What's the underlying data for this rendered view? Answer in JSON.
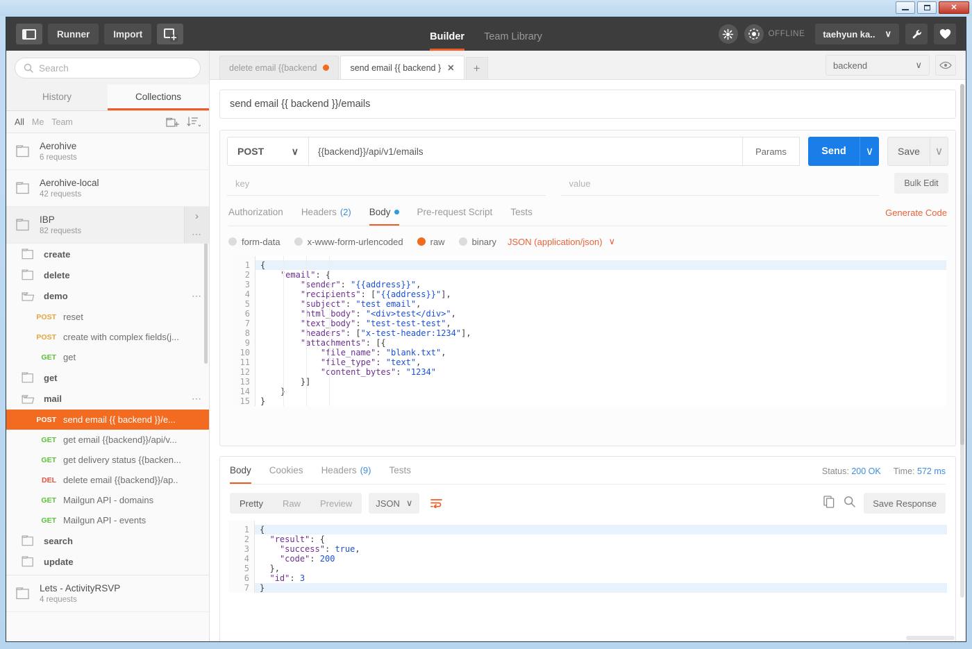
{
  "window": {
    "minimize_label": "minimize",
    "maximize_label": "maximize",
    "close_label": "✕"
  },
  "topnav": {
    "sidebar_toggle": "toggle-sidebar",
    "runner_label": "Runner",
    "import_label": "Import",
    "new_tab_label": "new-window",
    "center": [
      {
        "label": "Builder",
        "active": true
      },
      {
        "label": "Team Library",
        "active": false
      }
    ],
    "sync_icon": "broadcast-icon",
    "status_icon": "orbit-icon",
    "status_label": "OFFLINE",
    "user_name": "taehyun ka..",
    "user_caret": "∨",
    "wrench_icon": "wrench-icon",
    "heart_icon": "heart-icon"
  },
  "sidebar": {
    "search": {
      "placeholder": "Search"
    },
    "tabs": [
      {
        "label": "History",
        "active": false
      },
      {
        "label": "Collections",
        "active": true
      }
    ],
    "filters": [
      {
        "label": "All",
        "active": true
      },
      {
        "label": "Me",
        "active": false
      },
      {
        "label": "Team",
        "active": false
      }
    ],
    "new_folder_icon": "new-folder-icon",
    "sort_icon": "sort-icon",
    "collections": [
      {
        "name": "Aerohive",
        "requests": "6 requests"
      },
      {
        "name": "Aerohive-local",
        "requests": "42 requests"
      },
      {
        "name": "IBP",
        "requests": "82 requests",
        "expanded": true
      }
    ],
    "tree": [
      {
        "type": "folder",
        "name": "create",
        "open": false
      },
      {
        "type": "folder",
        "name": "delete",
        "open": false
      },
      {
        "type": "folder",
        "name": "demo",
        "open": true,
        "menu": "..."
      },
      {
        "type": "request",
        "method": "POST",
        "name": "reset"
      },
      {
        "type": "request",
        "method": "POST",
        "name": "create with complex fields(j..."
      },
      {
        "type": "request",
        "method": "GET",
        "name": "get"
      },
      {
        "type": "folder",
        "name": "get",
        "open": false
      },
      {
        "type": "folder",
        "name": "mail",
        "open": true,
        "menu": "..."
      },
      {
        "type": "request",
        "method": "POST",
        "name": "send email {{ backend }}/e...",
        "selected": true
      },
      {
        "type": "request",
        "method": "GET",
        "name": "get email {{backend}}/api/v..."
      },
      {
        "type": "request",
        "method": "GET",
        "name": "get delivery status {{backen..."
      },
      {
        "type": "request",
        "method": "DEL",
        "name": "delete email {{backend}}/ap.."
      },
      {
        "type": "request",
        "method": "GET",
        "name": "Mailgun API - domains"
      },
      {
        "type": "request",
        "method": "GET",
        "name": "Mailgun API - events"
      },
      {
        "type": "folder",
        "name": "search",
        "open": false
      },
      {
        "type": "folder",
        "name": "update",
        "open": false
      }
    ],
    "collections_bottom": [
      {
        "name": "Lets - ActivityRSVP",
        "requests": "4 requests"
      }
    ]
  },
  "tabs": {
    "items": [
      {
        "label": "delete email {{backend",
        "active": false,
        "unsaved": true
      },
      {
        "label": "send email {{ backend }",
        "active": true,
        "close": "✕"
      }
    ],
    "add_label": "+"
  },
  "environment": {
    "selected": "backend",
    "caret": "∨",
    "eye_icon": "eye-icon"
  },
  "request": {
    "title": "send email {{ backend }}/emails",
    "method": "POST",
    "method_caret": "∨",
    "url": "{{backend}}/api/v1/emails",
    "params_label": "Params",
    "send_label": "Send",
    "send_caret": "∨",
    "save_label": "Save",
    "save_caret": "∨",
    "key_placeholder": "key",
    "value_placeholder": "value",
    "bulk_edit_label": "Bulk Edit",
    "tabs": [
      {
        "label": "Authorization",
        "active": false
      },
      {
        "label": "Headers",
        "count": "(2)",
        "active": false
      },
      {
        "label": "Body",
        "active": true,
        "dot": true
      },
      {
        "label": "Pre-request Script",
        "active": false
      },
      {
        "label": "Tests",
        "active": false
      }
    ],
    "generate_code_label": "Generate Code",
    "body_types": [
      {
        "label": "form-data",
        "selected": false
      },
      {
        "label": "x-www-form-urlencoded",
        "selected": false
      },
      {
        "label": "raw",
        "selected": true
      },
      {
        "label": "binary",
        "selected": false
      }
    ],
    "content_type": "JSON (application/json)",
    "content_type_caret": "∨",
    "body_lines": [
      {
        "n": "1",
        "fold": true,
        "text": "{",
        "hl": true
      },
      {
        "n": "2",
        "fold": true,
        "text": "    \"email\": {"
      },
      {
        "n": "3",
        "text": "        \"sender\": \"{{address}}\","
      },
      {
        "n": "4",
        "text": "        \"recipients\": [\"{{address}}\"],"
      },
      {
        "n": "5",
        "text": "        \"subject\": \"test email\","
      },
      {
        "n": "6",
        "text": "        \"html_body\": \"<div>test</div>\","
      },
      {
        "n": "7",
        "text": "        \"text_body\": \"test-test-test\","
      },
      {
        "n": "8",
        "text": "        \"headers\": [\"x-test-header:1234\"],"
      },
      {
        "n": "9",
        "fold": true,
        "text": "        \"attachments\": [{"
      },
      {
        "n": "10",
        "text": "            \"file_name\": \"blank.txt\","
      },
      {
        "n": "11",
        "text": "            \"file_type\": \"text\","
      },
      {
        "n": "12",
        "text": "            \"content_bytes\": \"1234\""
      },
      {
        "n": "13",
        "text": "        }]"
      },
      {
        "n": "14",
        "text": "    }"
      },
      {
        "n": "15",
        "text": "}"
      }
    ]
  },
  "response": {
    "tabs": [
      {
        "label": "Body",
        "active": true
      },
      {
        "label": "Cookies",
        "active": false
      },
      {
        "label": "Headers",
        "count": "(9)",
        "active": false
      },
      {
        "label": "Tests",
        "active": false
      }
    ],
    "status_label": "Status:",
    "status_value": "200 OK",
    "time_label": "Time:",
    "time_value": "572 ms",
    "view_modes": [
      {
        "label": "Pretty",
        "active": true
      },
      {
        "label": "Raw",
        "active": false
      },
      {
        "label": "Preview",
        "active": false
      }
    ],
    "format": "JSON",
    "format_caret": "∨",
    "wrap_icon": "word-wrap-icon",
    "copy_icon": "copy-icon",
    "search_icon": "search-icon",
    "save_response_label": "Save Response",
    "body_lines": [
      {
        "n": "1",
        "fold": true,
        "text": "{",
        "hl": true
      },
      {
        "n": "2",
        "fold": true,
        "text": "  \"result\": {"
      },
      {
        "n": "3",
        "text": "    \"success\": true,"
      },
      {
        "n": "4",
        "text": "    \"code\": 200"
      },
      {
        "n": "5",
        "text": "  },"
      },
      {
        "n": "6",
        "text": "  \"id\": 3"
      },
      {
        "n": "7",
        "text": "}",
        "hl": true
      }
    ]
  },
  "colors": {
    "accent": "#ef5b25",
    "selected_request": "#f26b21",
    "send_blue": "#1a7ee8",
    "link_blue": "#3c8dde",
    "method_post": "#e8a33d",
    "method_get": "#5bc236",
    "method_del": "#e8503a",
    "topnav_bg": "#3d3d3d"
  }
}
